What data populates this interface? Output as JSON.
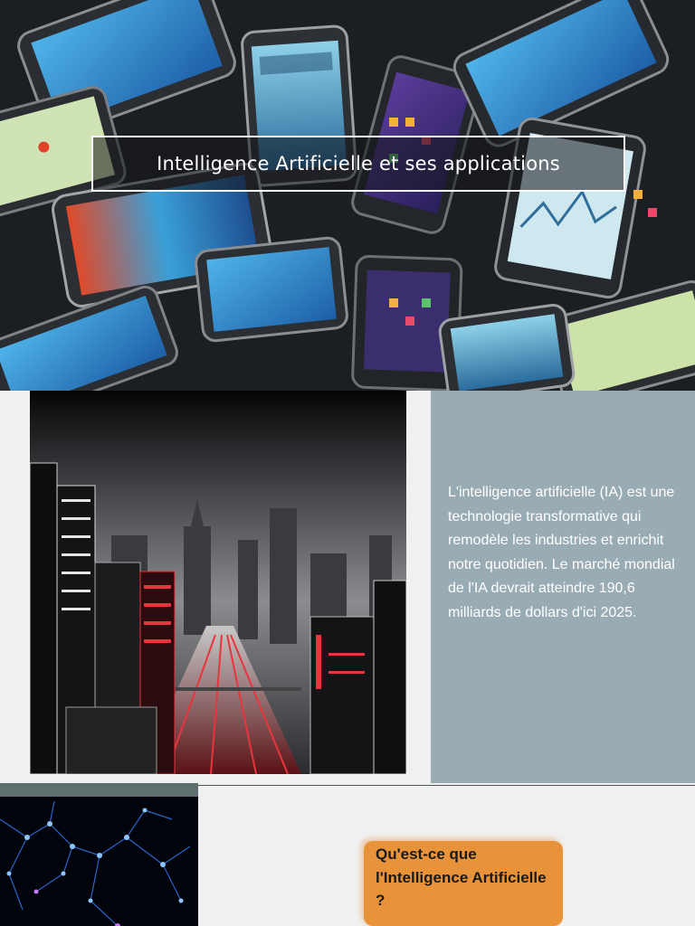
{
  "hero": {
    "title": "Intelligence Artificielle et ses applications",
    "image_icon": "phones-collage-image"
  },
  "city_image": {
    "icon": "futuristic-city-image"
  },
  "info": {
    "text": "L'intelligence artificielle (IA) est une technologie transformative qui remodèle les industries et enrichit notre quotidien. Le marché mondial de l'IA devrait atteindre 190,6 milliards de dollars d'ici 2025."
  },
  "network_image": {
    "icon": "neural-network-image"
  },
  "callout": {
    "label": "Qu'est-ce que l'Intelligence Artificielle ?"
  },
  "colors": {
    "info_panel": "#9aacb3",
    "callout": "#e8923a",
    "page_bg": "#f0f0f0"
  }
}
